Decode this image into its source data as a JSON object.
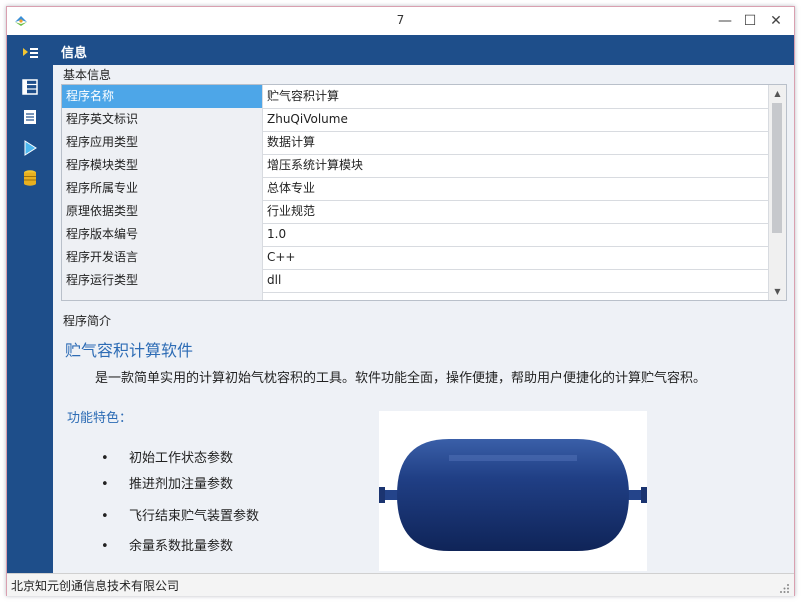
{
  "window": {
    "title": "7"
  },
  "titlebar": {
    "minimize": "—",
    "maximize": "☐",
    "close": "✕"
  },
  "header": {
    "title": "信息"
  },
  "basic": {
    "label": "基本信息",
    "rows": [
      {
        "key": "程序名称",
        "value": "贮气容积计算"
      },
      {
        "key": "程序英文标识",
        "value": "ZhuQiVolume"
      },
      {
        "key": "程序应用类型",
        "value": "数据计算"
      },
      {
        "key": "程序模块类型",
        "value": "增压系统计算模块"
      },
      {
        "key": "程序所属专业",
        "value": "总体专业"
      },
      {
        "key": "原理依据类型",
        "value": "行业规范"
      },
      {
        "key": "程序版本编号",
        "value": "1.0"
      },
      {
        "key": "程序开发语言",
        "value": "C++"
      },
      {
        "key": "程序运行类型",
        "value": "dll"
      }
    ]
  },
  "intro": {
    "label": "程序简介",
    "title": "贮气容积计算软件",
    "description": "是一款简单实用的计算初始气枕容积的工具。软件功能全面，操作便捷，帮助用户便捷化的计算贮气容积。",
    "features_title": "功能特色：",
    "bullet": "•",
    "features": [
      "初始工作状态参数",
      "推进剂加注量参数",
      "飞行结束贮气装置参数",
      "余量系数批量参数"
    ]
  },
  "status": {
    "text": "北京知元创通信息技术有限公司"
  },
  "colors": {
    "sidebar": "#1e4e8a",
    "selected_row": "#4da6e8",
    "accent_text": "#2d6cb5",
    "tank": "#1c3a78"
  }
}
